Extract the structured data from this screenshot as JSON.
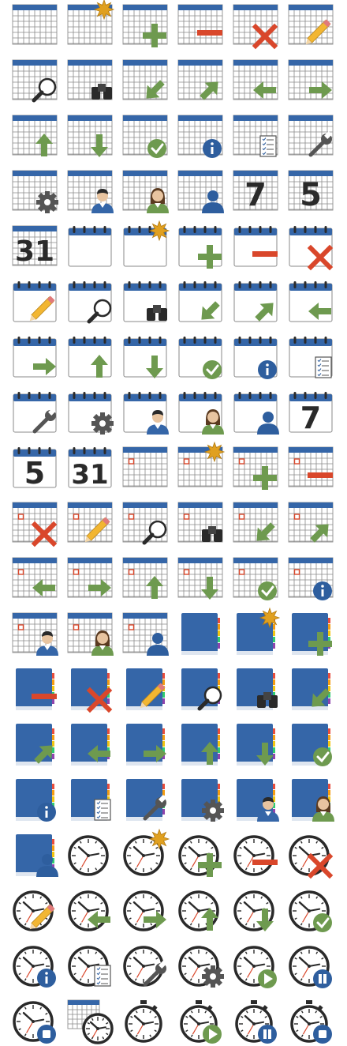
{
  "sheet": {
    "colors": {
      "blue": "#3566a8",
      "green": "#6e9a4f",
      "red": "#d9472b",
      "dark": "#2a2a2a",
      "grid": "#8a8a8a",
      "gear": "#555555",
      "star": "#e0a020",
      "info": "#2e5e9e"
    },
    "rows": [
      [
        {
          "base": "calendar-grid",
          "badge": "none"
        },
        {
          "base": "calendar-grid",
          "badge": "star"
        },
        {
          "base": "calendar-grid",
          "badge": "plus"
        },
        {
          "base": "calendar-grid",
          "badge": "minus"
        },
        {
          "base": "calendar-grid",
          "badge": "x"
        },
        {
          "base": "calendar-grid",
          "badge": "pencil"
        }
      ],
      [
        {
          "base": "calendar-grid",
          "badge": "magnifier"
        },
        {
          "base": "calendar-grid",
          "badge": "binoculars"
        },
        {
          "base": "calendar-grid",
          "badge": "arrow-down-left"
        },
        {
          "base": "calendar-grid",
          "badge": "arrow-up-right"
        },
        {
          "base": "calendar-grid",
          "badge": "arrow-left"
        },
        {
          "base": "calendar-grid",
          "badge": "arrow-right"
        }
      ],
      [
        {
          "base": "calendar-grid",
          "badge": "arrow-up"
        },
        {
          "base": "calendar-grid",
          "badge": "arrow-down"
        },
        {
          "base": "calendar-grid",
          "badge": "check"
        },
        {
          "base": "calendar-grid",
          "badge": "info"
        },
        {
          "base": "calendar-grid",
          "badge": "checklist"
        },
        {
          "base": "calendar-grid",
          "badge": "wrench"
        }
      ],
      [
        {
          "base": "calendar-grid",
          "badge": "gear"
        },
        {
          "base": "calendar-grid",
          "badge": "man"
        },
        {
          "base": "calendar-grid",
          "badge": "woman"
        },
        {
          "base": "calendar-grid",
          "badge": "user"
        },
        {
          "base": "calendar-number",
          "number": "7",
          "badge": "none"
        },
        {
          "base": "calendar-number",
          "number": "5",
          "badge": "none"
        }
      ],
      [
        {
          "base": "calendar-number",
          "number": "31",
          "badge": "none"
        },
        {
          "base": "calendar-ring",
          "badge": "none"
        },
        {
          "base": "calendar-ring",
          "badge": "star"
        },
        {
          "base": "calendar-ring",
          "badge": "plus"
        },
        {
          "base": "calendar-ring",
          "badge": "minus"
        },
        {
          "base": "calendar-ring",
          "badge": "x"
        }
      ],
      [
        {
          "base": "calendar-ring",
          "badge": "pencil"
        },
        {
          "base": "calendar-ring",
          "badge": "magnifier"
        },
        {
          "base": "calendar-ring",
          "badge": "binoculars"
        },
        {
          "base": "calendar-ring",
          "badge": "arrow-down-left"
        },
        {
          "base": "calendar-ring",
          "badge": "arrow-up-right"
        },
        {
          "base": "calendar-ring",
          "badge": "arrow-left"
        }
      ],
      [
        {
          "base": "calendar-ring",
          "badge": "arrow-right"
        },
        {
          "base": "calendar-ring",
          "badge": "arrow-up"
        },
        {
          "base": "calendar-ring",
          "badge": "arrow-down"
        },
        {
          "base": "calendar-ring",
          "badge": "check"
        },
        {
          "base": "calendar-ring",
          "badge": "info"
        },
        {
          "base": "calendar-ring",
          "badge": "checklist"
        }
      ],
      [
        {
          "base": "calendar-ring",
          "badge": "wrench"
        },
        {
          "base": "calendar-ring",
          "badge": "gear"
        },
        {
          "base": "calendar-ring",
          "badge": "man"
        },
        {
          "base": "calendar-ring",
          "badge": "woman"
        },
        {
          "base": "calendar-ring",
          "badge": "user"
        },
        {
          "base": "calendar-ring-number",
          "number": "7",
          "badge": "none"
        }
      ],
      [
        {
          "base": "calendar-ring-number",
          "number": "5",
          "badge": "none"
        },
        {
          "base": "calendar-ring-number",
          "number": "31",
          "badge": "none"
        },
        {
          "base": "calendar-grid-day",
          "badge": "none"
        },
        {
          "base": "calendar-grid-day",
          "badge": "star"
        },
        {
          "base": "calendar-grid-day",
          "badge": "plus"
        },
        {
          "base": "calendar-grid-day",
          "badge": "minus"
        }
      ],
      [
        {
          "base": "calendar-grid-day",
          "badge": "x"
        },
        {
          "base": "calendar-grid-day",
          "badge": "pencil"
        },
        {
          "base": "calendar-grid-day",
          "badge": "magnifier"
        },
        {
          "base": "calendar-grid-day",
          "badge": "binoculars"
        },
        {
          "base": "calendar-grid-day",
          "badge": "arrow-down-left"
        },
        {
          "base": "calendar-grid-day",
          "badge": "arrow-up-right"
        }
      ],
      [
        {
          "base": "calendar-grid-day",
          "badge": "arrow-left"
        },
        {
          "base": "calendar-grid-day",
          "badge": "arrow-right"
        },
        {
          "base": "calendar-grid-day",
          "badge": "arrow-up"
        },
        {
          "base": "calendar-grid-day",
          "badge": "arrow-down"
        },
        {
          "base": "calendar-grid-day",
          "badge": "check"
        },
        {
          "base": "calendar-grid-day",
          "badge": "info"
        }
      ],
      [
        {
          "base": "calendar-grid-day",
          "badge": "man"
        },
        {
          "base": "calendar-grid-day",
          "badge": "woman"
        },
        {
          "base": "calendar-grid-day",
          "badge": "user"
        },
        {
          "base": "address-book",
          "badge": "none"
        },
        {
          "base": "address-book",
          "badge": "star"
        },
        {
          "base": "address-book",
          "badge": "plus"
        }
      ],
      [
        {
          "base": "address-book",
          "badge": "minus"
        },
        {
          "base": "address-book",
          "badge": "x"
        },
        {
          "base": "address-book",
          "badge": "pencil"
        },
        {
          "base": "address-book",
          "badge": "magnifier"
        },
        {
          "base": "address-book",
          "badge": "binoculars"
        },
        {
          "base": "address-book",
          "badge": "arrow-down-left"
        }
      ],
      [
        {
          "base": "address-book",
          "badge": "arrow-up-right"
        },
        {
          "base": "address-book",
          "badge": "arrow-left"
        },
        {
          "base": "address-book",
          "badge": "arrow-right"
        },
        {
          "base": "address-book",
          "badge": "arrow-up"
        },
        {
          "base": "address-book",
          "badge": "arrow-down"
        },
        {
          "base": "address-book",
          "badge": "check"
        }
      ],
      [
        {
          "base": "address-book",
          "badge": "info"
        },
        {
          "base": "address-book",
          "badge": "checklist"
        },
        {
          "base": "address-book",
          "badge": "wrench"
        },
        {
          "base": "address-book",
          "badge": "gear"
        },
        {
          "base": "address-book",
          "badge": "man"
        },
        {
          "base": "address-book",
          "badge": "woman"
        }
      ],
      [
        {
          "base": "address-book",
          "badge": "user"
        },
        {
          "base": "clock",
          "badge": "none"
        },
        {
          "base": "clock",
          "badge": "star"
        },
        {
          "base": "clock",
          "badge": "plus"
        },
        {
          "base": "clock",
          "badge": "minus"
        },
        {
          "base": "clock",
          "badge": "x"
        }
      ],
      [
        {
          "base": "clock",
          "badge": "pencil"
        },
        {
          "base": "clock",
          "badge": "arrow-left"
        },
        {
          "base": "clock",
          "badge": "arrow-right"
        },
        {
          "base": "clock",
          "badge": "arrow-up"
        },
        {
          "base": "clock",
          "badge": "arrow-down"
        },
        {
          "base": "clock",
          "badge": "check"
        }
      ],
      [
        {
          "base": "clock",
          "badge": "info"
        },
        {
          "base": "clock",
          "badge": "checklist"
        },
        {
          "base": "clock",
          "badge": "wrench"
        },
        {
          "base": "clock",
          "badge": "gear"
        },
        {
          "base": "clock",
          "badge": "play"
        },
        {
          "base": "clock",
          "badge": "pause"
        }
      ],
      [
        {
          "base": "clock",
          "badge": "stop"
        },
        {
          "base": "calendar-clock",
          "badge": "none"
        },
        {
          "base": "stopwatch",
          "badge": "none"
        },
        {
          "base": "stopwatch",
          "badge": "play"
        },
        {
          "base": "stopwatch",
          "badge": "pause"
        },
        {
          "base": "stopwatch",
          "badge": "stop"
        }
      ]
    ]
  }
}
